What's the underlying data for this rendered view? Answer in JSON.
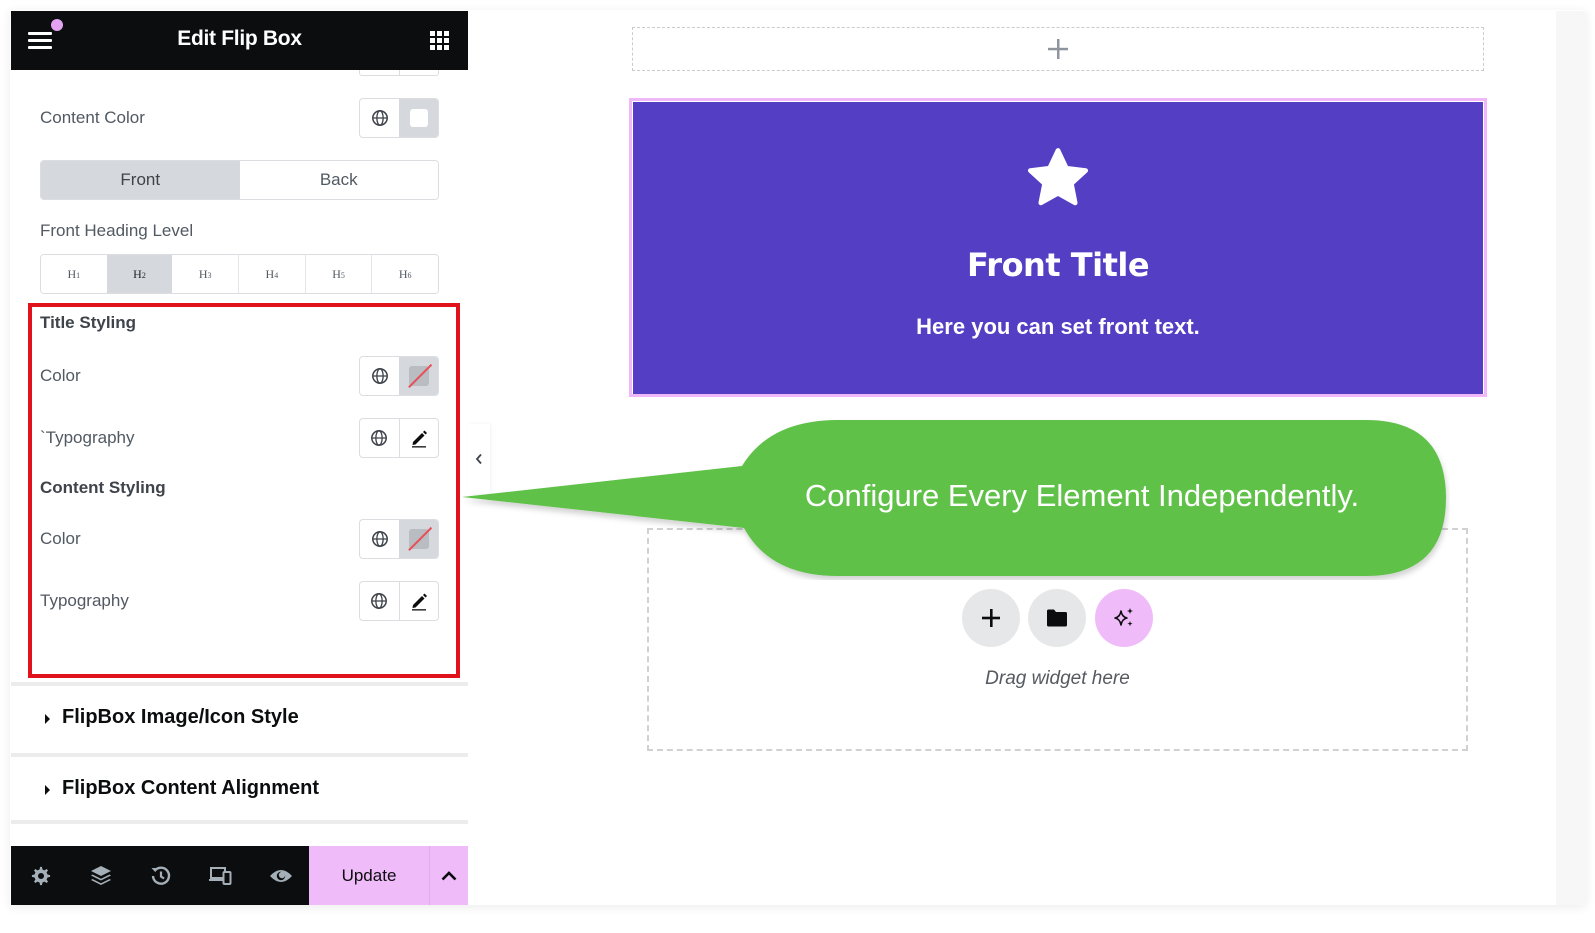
{
  "sidebar": {
    "title": "Edit Flip Box",
    "content_color_label": "Content Color",
    "side_tabs": [
      {
        "label": "Front",
        "active": true
      },
      {
        "label": "Back",
        "active": false
      }
    ],
    "heading_level_label": "Front Heading Level",
    "heading_levels": [
      {
        "label": "H",
        "sub": "1",
        "active": false
      },
      {
        "label": "H",
        "sub": "2",
        "active": true
      },
      {
        "label": "H",
        "sub": "3",
        "active": false
      },
      {
        "label": "H",
        "sub": "4",
        "active": false
      },
      {
        "label": "H",
        "sub": "5",
        "active": false
      },
      {
        "label": "H",
        "sub": "6",
        "active": false
      }
    ],
    "title_styling": {
      "heading": "Title Styling",
      "color_label": "Color",
      "typography_label": "`Typography"
    },
    "content_styling": {
      "heading": "Content Styling",
      "color_label": "Color",
      "typography_label": "Typography"
    },
    "accordions": [
      {
        "label": "FlipBox Image/Icon Style"
      },
      {
        "label": "FlipBox Content Alignment"
      }
    ],
    "footer": {
      "icons": [
        "settings-icon",
        "layers-icon",
        "history-icon",
        "responsive-icon",
        "preview-icon"
      ],
      "update_label": "Update"
    }
  },
  "canvas": {
    "flipbox": {
      "icon": "star-icon",
      "title": "Front Title",
      "text": "Here you can set front text.",
      "background": "#533ec4"
    },
    "drop_zone": {
      "hint": "Drag widget here"
    }
  },
  "callout": {
    "text": "Configure Every Element Independently.",
    "color": "#60c14a"
  },
  "colors": {
    "highlight": "#e0121b",
    "accent_pink": "#efbbf9",
    "dark": "#0c0d0e"
  }
}
